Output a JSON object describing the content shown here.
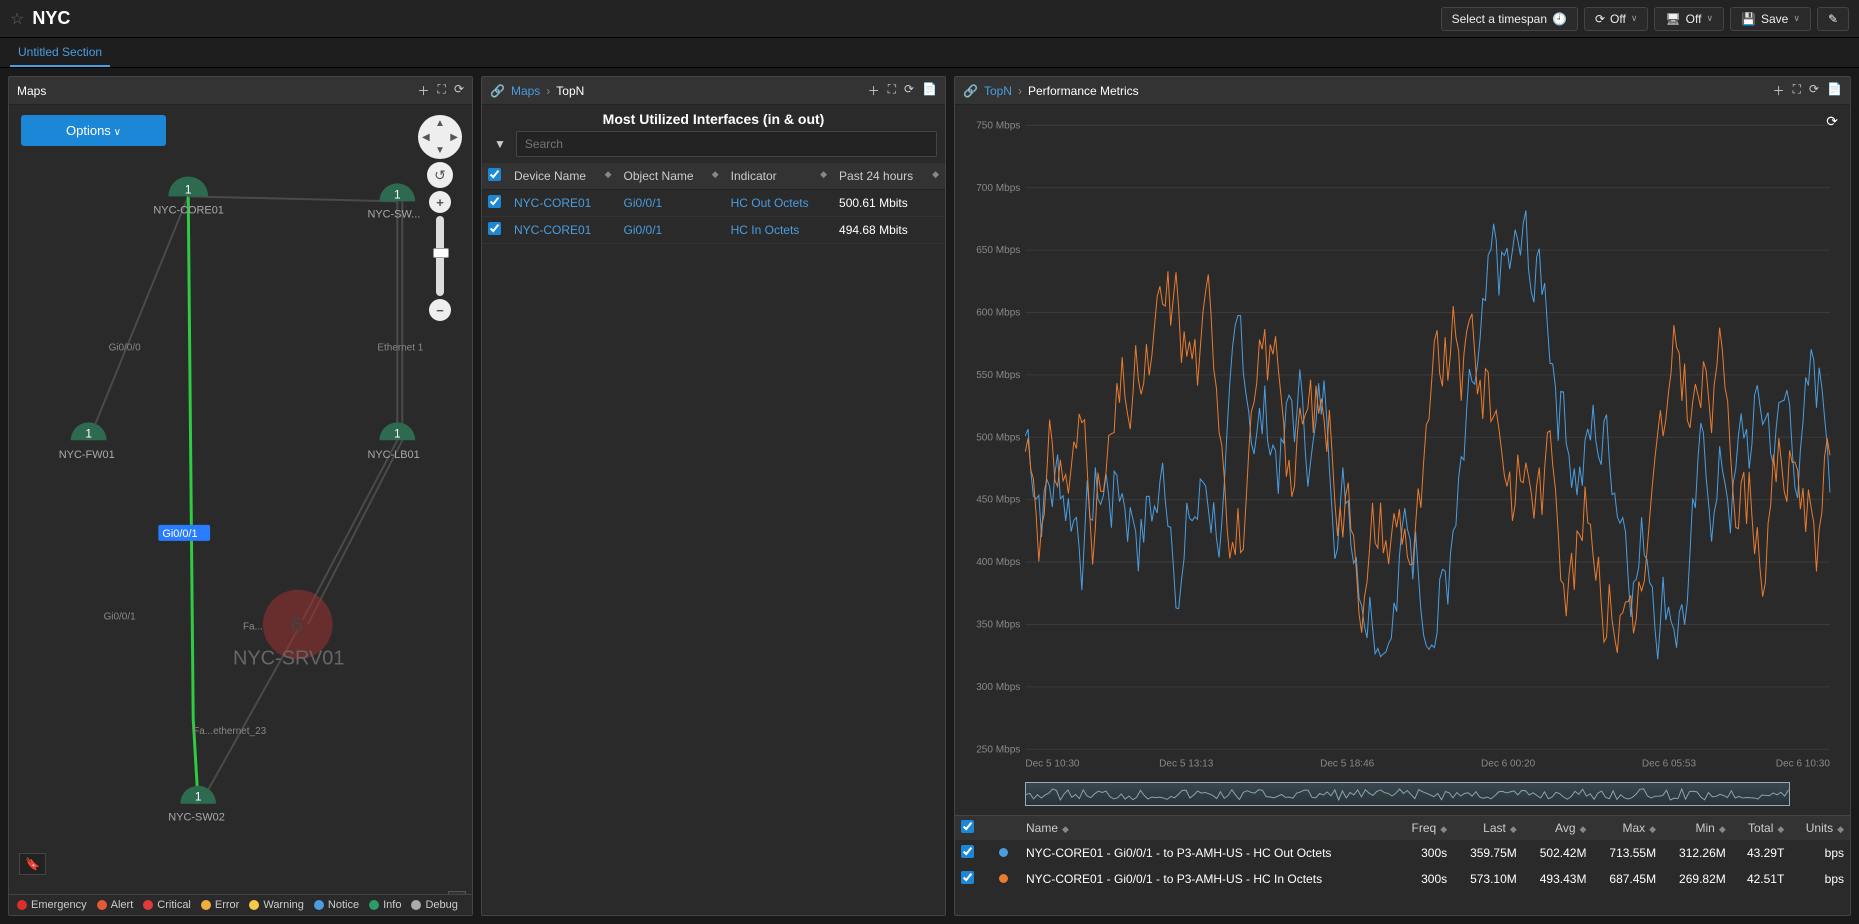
{
  "page_title": "NYC",
  "topbar": {
    "timespan": "Select a timespan",
    "off1": "Off",
    "off2": "Off",
    "save": "Save"
  },
  "tabs": [
    {
      "label": "Untitled Section"
    }
  ],
  "maps_panel": {
    "title": "Maps",
    "options_label": "Options",
    "selected_link": "Gi0/0/1",
    "nodes": {
      "core": {
        "label": "NYC-CORE01",
        "badge": "1"
      },
      "sw01": {
        "label": "NYC-SW...",
        "badge": "1"
      },
      "fw01": {
        "label": "NYC-FW01",
        "badge": "1"
      },
      "lb01": {
        "label": "NYC-LB01",
        "badge": "1"
      },
      "srv01": {
        "label": "NYC-SRV01",
        "badge": "6"
      },
      "sw02": {
        "label": "NYC-SW02",
        "badge": "1"
      }
    },
    "edges": {
      "g0": "Gi0/0/0",
      "g1": "Gi0/0/1",
      "eth1": "Ethernet 1",
      "fa": "Fa...",
      "fae23": "Fa...ethernet_23"
    },
    "legend": [
      "Emergency",
      "Alert",
      "Critical",
      "Error",
      "Warning",
      "Notice",
      "Info",
      "Debug"
    ]
  },
  "topn_panel": {
    "breadcrumb": [
      "Maps",
      "TopN"
    ],
    "subtitle": "Most Utilized Interfaces (in & out)",
    "search_placeholder": "Search",
    "columns": [
      "Device Name",
      "Object Name",
      "Indicator",
      "Past 24 hours"
    ],
    "rows": [
      {
        "device": "NYC-CORE01",
        "object": "Gi0/0/1",
        "indicator": "HC Out Octets",
        "value": "500.61 Mbits"
      },
      {
        "device": "NYC-CORE01",
        "object": "Gi0/0/1",
        "indicator": "HC In Octets",
        "value": "494.68 Mbits"
      }
    ]
  },
  "perf_panel": {
    "breadcrumb": [
      "TopN",
      "Performance Metrics"
    ],
    "y_ticks": [
      "750 Mbps",
      "700 Mbps",
      "650 Mbps",
      "600 Mbps",
      "550 Mbps",
      "500 Mbps",
      "450 Mbps",
      "400 Mbps",
      "350 Mbps",
      "300 Mbps",
      "250 Mbps"
    ],
    "x_ticks": [
      "Dec 5 10:30",
      "Dec 5 13:13",
      "Dec 5 18:46",
      "Dec 6 00:20",
      "Dec 6 05:53",
      "Dec 6 10:30"
    ],
    "table_cols": [
      "Name",
      "Freq",
      "Last",
      "Avg",
      "Max",
      "Min",
      "Total",
      "Units"
    ],
    "table_rows": [
      {
        "name": "NYC-CORE01 - Gi0/0/1 - to P3-AMH-US - HC Out Octets",
        "freq": "300s",
        "last": "359.75M",
        "avg": "502.42M",
        "max": "713.55M",
        "min": "312.26M",
        "total": "43.29T",
        "units": "bps",
        "color": "blue"
      },
      {
        "name": "NYC-CORE01 - Gi0/0/1 - to P3-AMH-US - HC In Octets",
        "freq": "300s",
        "last": "573.10M",
        "avg": "493.43M",
        "max": "687.45M",
        "min": "269.82M",
        "total": "42.51T",
        "units": "bps",
        "color": "orange"
      }
    ]
  },
  "chart_data": {
    "type": "line",
    "title": "",
    "xlabel": "",
    "ylabel": "Mbps",
    "ylim": [
      250,
      750
    ],
    "x_range": [
      "Dec 5 10:30",
      "Dec 6 10:30"
    ],
    "series": [
      {
        "name": "HC Out Octets",
        "color": "#4a9de0",
        "approx_mean": 502,
        "approx_min": 312,
        "approx_max": 713
      },
      {
        "name": "HC In Octets",
        "color": "#e87b2f",
        "approx_mean": 493,
        "approx_min": 270,
        "approx_max": 687
      }
    ],
    "note": "Dense 24h sampling; individual points estimated via random walk around mean"
  }
}
